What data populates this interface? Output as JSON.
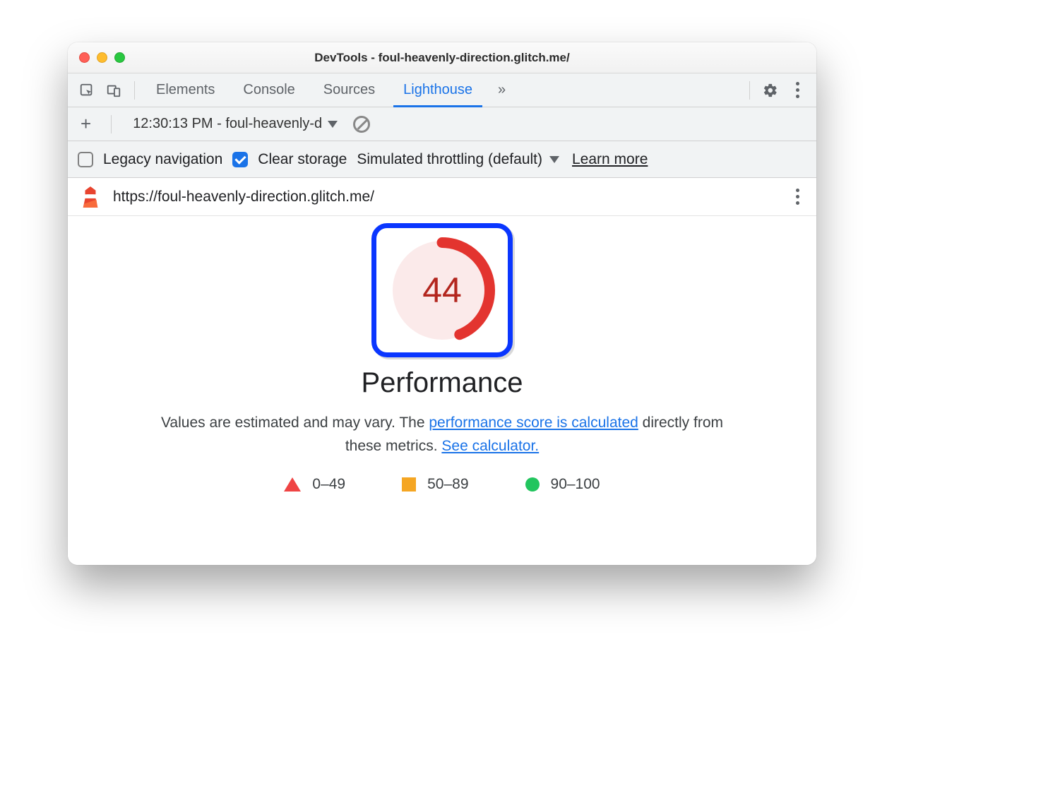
{
  "window": {
    "title": "DevTools - foul-heavenly-direction.glitch.me/"
  },
  "tabs": {
    "elements": "Elements",
    "console": "Console",
    "sources": "Sources",
    "lighthouse": "Lighthouse"
  },
  "subbar": {
    "report_label": "12:30:13 PM - foul-heavenly-d"
  },
  "options": {
    "legacy_navigation": "Legacy navigation",
    "clear_storage": "Clear storage",
    "throttling": "Simulated throttling (default)",
    "learn_more": "Learn more"
  },
  "report": {
    "url": "https://foul-heavenly-direction.glitch.me/",
    "score": "44",
    "category": "Performance",
    "desc_pre": "Values are estimated and may vary. The ",
    "desc_link1": "performance score is calculated",
    "desc_mid": " directly from these metrics. ",
    "desc_link2": "See calculator.",
    "legend": {
      "poor": "0–49",
      "avg": "50–89",
      "good": "90–100"
    }
  },
  "chart_data": {
    "type": "pie",
    "title": "Performance",
    "categories": [
      "Performance score"
    ],
    "values": [
      44
    ],
    "ylim": [
      0,
      100
    ],
    "legend_ranges": [
      {
        "label": "0–49",
        "color": "#ef4444"
      },
      {
        "label": "50–89",
        "color": "#f5a623"
      },
      {
        "label": "90–100",
        "color": "#22c55e"
      }
    ]
  }
}
